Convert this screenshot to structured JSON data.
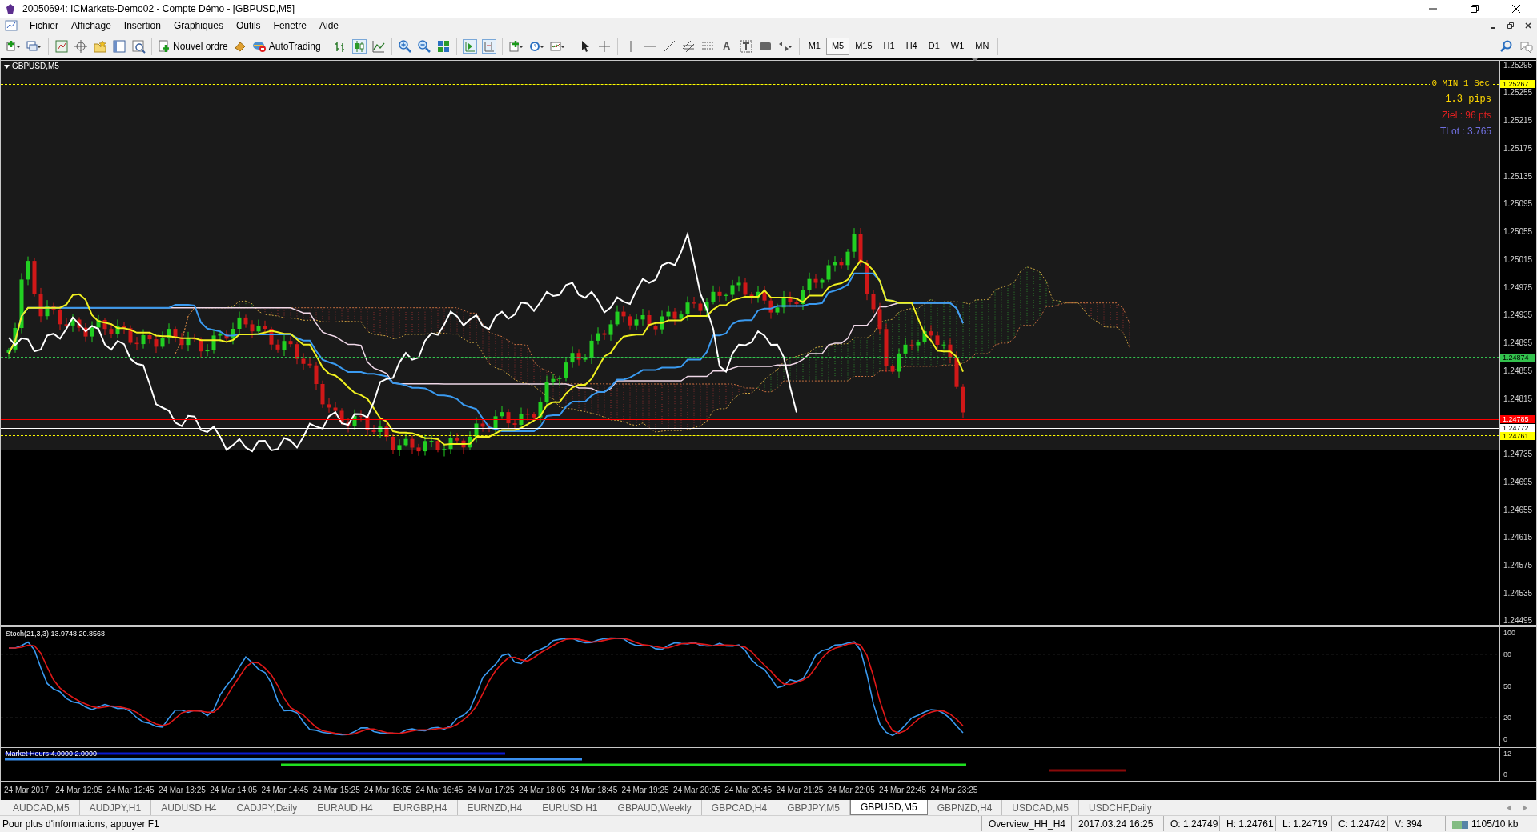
{
  "window": {
    "title": "20050694: ICMarkets-Demo02 - Compte Démo - [GBPUSD,M5]"
  },
  "menu": [
    "Fichier",
    "Affichage",
    "Insertion",
    "Graphiques",
    "Outils",
    "Fenetre",
    "Aide"
  ],
  "toolbar": {
    "new_order": "Nouvel ordre",
    "autotrading": "AutoTrading",
    "text_tool": "A",
    "timeframes": [
      {
        "label": "M1",
        "selected": false
      },
      {
        "label": "M5",
        "selected": true
      },
      {
        "label": "M15",
        "selected": false
      },
      {
        "label": "H1",
        "selected": false
      },
      {
        "label": "H4",
        "selected": false
      },
      {
        "label": "D1",
        "selected": false
      },
      {
        "label": "W1",
        "selected": false
      },
      {
        "label": "MN",
        "selected": false
      }
    ]
  },
  "chart": {
    "symbol": "GBPUSD,M5",
    "countdown": "0 MIN 1 Sec",
    "spread": "1.3 pips",
    "target": "Ziel : 96 pts",
    "lot": "TLot : 3.765",
    "price_axis": [
      "1.25295",
      "1.25255",
      "1.25215",
      "1.25175",
      "1.25135",
      "1.25095",
      "1.25055",
      "1.25015",
      "1.24975",
      "1.24935",
      "1.24895",
      "1.24855",
      "1.24815",
      "1.24735",
      "1.24695",
      "1.24655",
      "1.24615",
      "1.24575",
      "1.24535",
      "1.24495"
    ],
    "price_tags": [
      {
        "text": "1.25267",
        "color": "#ffff00",
        "dashed": true
      },
      {
        "text": "1.24874",
        "color": "#33c24d",
        "dashed": true
      },
      {
        "text": "1.24785",
        "color": "#ff0000",
        "dashed": false
      },
      {
        "text": "1.24772",
        "color": "#ffffff",
        "dashed": false
      },
      {
        "text": "1.24761",
        "color": "#ffff00",
        "dashed": true
      }
    ]
  },
  "stochastic": {
    "label": "Stoch(21,3,3) 13.9748 20.8568",
    "axis": [
      "100",
      "80",
      "50",
      "20",
      "0"
    ]
  },
  "market_hours": {
    "label": "Market Hours 4.0000 2.0000",
    "axis": [
      "12",
      "0"
    ]
  },
  "time_axis": [
    "24 Mar 2017",
    "24 Mar 12:05",
    "24 Mar 12:45",
    "24 Mar 13:25",
    "24 Mar 14:05",
    "24 Mar 14:45",
    "24 Mar 15:25",
    "24 Mar 16:05",
    "24 Mar 16:45",
    "24 Mar 17:25",
    "24 Mar 18:05",
    "24 Mar 18:45",
    "24 Mar 19:25",
    "24 Mar 20:05",
    "24 Mar 20:45",
    "24 Mar 21:25",
    "24 Mar 22:05",
    "24 Mar 22:45",
    "24 Mar 23:25"
  ],
  "tabs": [
    {
      "label": "AUDCAD,M5",
      "selected": false
    },
    {
      "label": "AUDJPY,H1",
      "selected": false
    },
    {
      "label": "AUDUSD,H4",
      "selected": false
    },
    {
      "label": "CADJPY,Daily",
      "selected": false
    },
    {
      "label": "EURAUD,H4",
      "selected": false
    },
    {
      "label": "EURGBP,H4",
      "selected": false
    },
    {
      "label": "EURNZD,H4",
      "selected": false
    },
    {
      "label": "EURUSD,H1",
      "selected": false
    },
    {
      "label": "GBPAUD,Weekly",
      "selected": false
    },
    {
      "label": "GBPCAD,H4",
      "selected": false
    },
    {
      "label": "GBPJPY,M5",
      "selected": false
    },
    {
      "label": "GBPUSD,M5",
      "selected": true
    },
    {
      "label": "GBPNZD,H4",
      "selected": false
    },
    {
      "label": "USDCAD,M5",
      "selected": false
    },
    {
      "label": "USDCHF,Daily",
      "selected": false
    }
  ],
  "status_bar": {
    "help": "Pour plus d'informations, appuyer F1",
    "profile": "Overview_HH_H4",
    "time": "2017.03.24 16:25",
    "open": "O: 1.24749",
    "high": "H: 1.24761",
    "low": "L: 1.24719",
    "close": "C: 1.24742",
    "volume": "V: 394",
    "traffic": "1105/10 kb"
  }
}
